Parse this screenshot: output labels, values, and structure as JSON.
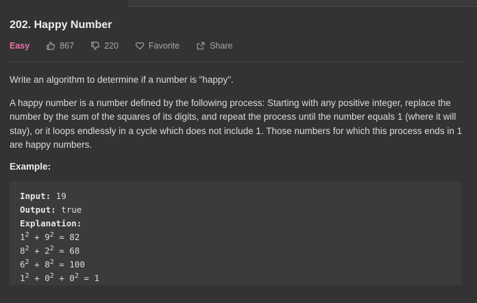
{
  "problem": {
    "title": "202. Happy Number",
    "difficulty": "Easy",
    "likes": "867",
    "dislikes": "220",
    "favorite_label": "Favorite",
    "share_label": "Share"
  },
  "description": {
    "p1": "Write an algorithm to determine if a number is \"happy\".",
    "p2": "A happy number is a number defined by the following process: Starting with any positive integer, replace the number by the sum of the squares of its digits, and repeat the process until the number equals 1 (where it will stay), or it loops endlessly in a cycle which does not include 1. Those numbers for which this process ends in 1 are happy numbers.",
    "example_heading": "Example:"
  },
  "example": {
    "input_label": "Input:",
    "input_value": " 19",
    "output_label": "Output:",
    "output_value": " true",
    "explanation_label": "Explanation:",
    "steps": [
      {
        "a": "1",
        "b": "9",
        "result": "82"
      },
      {
        "a": "8",
        "b": "2",
        "result": "68"
      },
      {
        "a": "6",
        "b": "8",
        "result": "100"
      }
    ],
    "last_step": {
      "a": "1",
      "b": "0",
      "c": "0",
      "result": "1"
    },
    "exponent": "2"
  },
  "colors": {
    "background": "#333333",
    "difficulty_easy": "#ef6fa6",
    "code_bg": "#3b3b3b"
  },
  "icons": [
    "thumbs-up-icon",
    "thumbs-down-icon",
    "heart-icon",
    "share-icon"
  ]
}
